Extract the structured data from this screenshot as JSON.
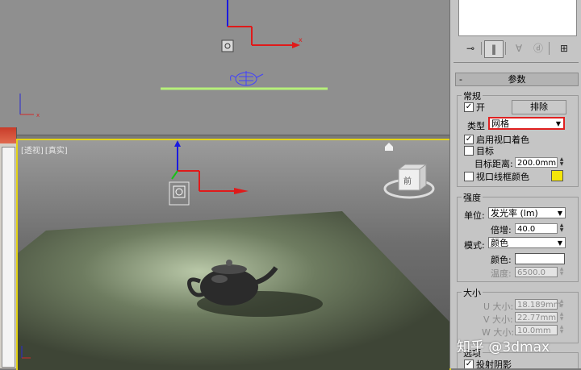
{
  "viewport_top": {},
  "viewport_persp": {
    "labels": [
      "[透视]",
      "[真实]"
    ]
  },
  "panel": {
    "rollout_title": "参数",
    "rollout_toggle": "-",
    "general": {
      "title": "常规",
      "on_label": "开",
      "on_checked": true,
      "exclude_button": "排除",
      "type_label": "类型",
      "type_value": "网格",
      "viewport_shading_label": "启用视口着色",
      "viewport_shading_checked": true,
      "target_label": "目标",
      "target_checked": false,
      "target_distance_label": "目标距离:",
      "target_distance_value": "200.0mm",
      "wireframe_color_label": "视口线框颜色",
      "wireframe_color_checked": false,
      "wireframe_color": "#f5e60a"
    },
    "intensity": {
      "title": "强度",
      "unit_label": "单位:",
      "unit_value": "发光率 (lm)",
      "multiplier_label": "倍增:",
      "multiplier_value": "40.0",
      "mode_label": "模式:",
      "mode_value": "颜色",
      "color_label": "颜色:",
      "color_value": "#ffffff",
      "temperature_label": "温度:",
      "temperature_value": "6500.0"
    },
    "size": {
      "title": "大小",
      "u_label": "U 大小:",
      "u_value": "18.189mm",
      "v_label": "V 大小:",
      "v_value": "22.77mm",
      "w_label": "W 大小:",
      "w_value": "10.0mm"
    },
    "options": {
      "title": "选项",
      "cast_shadows_label": "投射阴影",
      "cast_shadows_checked": true
    }
  },
  "watermark": "知乎 @3dmax",
  "colors": {
    "active_viewport_border": "#e3d317",
    "highlight_dropdown": "#e02020"
  }
}
